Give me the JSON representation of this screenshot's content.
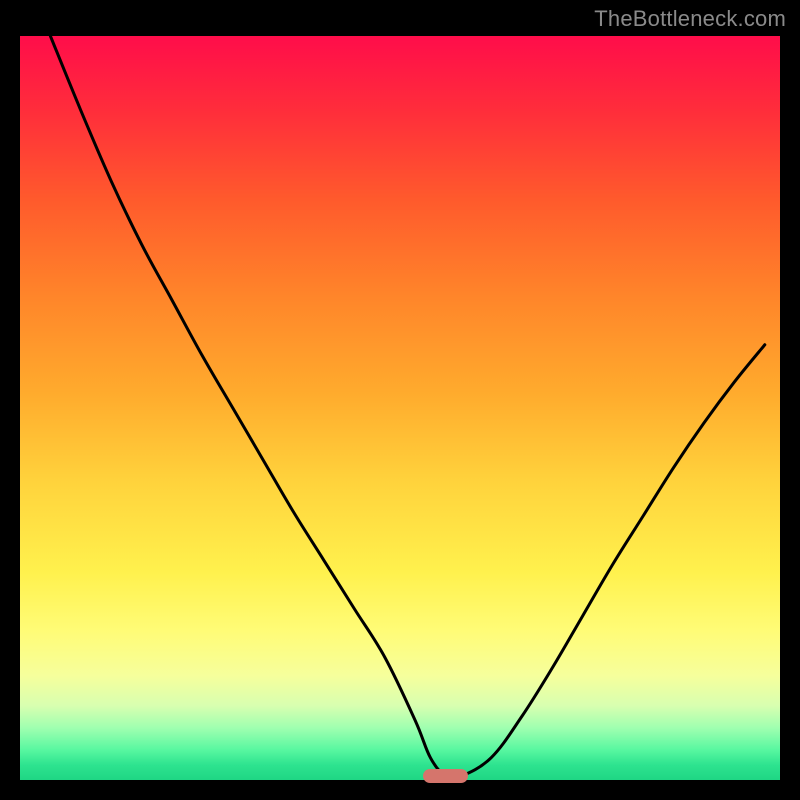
{
  "watermark": "TheBottleneck.com",
  "chart_data": {
    "type": "line",
    "title": "",
    "xlabel": "",
    "ylabel": "",
    "xlim": [
      0,
      100
    ],
    "ylim": [
      0,
      100
    ],
    "grid": false,
    "legend": false,
    "background_gradient": {
      "top": "#ff0d4a",
      "mid": "#ffd33c",
      "bottom": "#1fd684"
    },
    "series": [
      {
        "name": "bottleneck-curve",
        "x": [
          4.0,
          8.0,
          12.0,
          16.0,
          20.0,
          24.0,
          28.0,
          32.0,
          36.0,
          40.0,
          44.0,
          48.0,
          52.0,
          54.0,
          56.0,
          58.0,
          62.0,
          66.0,
          70.0,
          74.0,
          78.0,
          82.0,
          86.0,
          90.0,
          94.0,
          98.0
        ],
        "y": [
          100.0,
          90.0,
          80.5,
          72.0,
          64.5,
          57.0,
          50.0,
          43.0,
          36.0,
          29.5,
          23.0,
          16.5,
          8.0,
          3.0,
          0.5,
          0.5,
          3.0,
          8.5,
          15.0,
          22.0,
          29.0,
          35.5,
          42.0,
          48.0,
          53.5,
          58.5
        ],
        "stroke": "#000000",
        "stroke_width": 3
      }
    ],
    "marker": {
      "name": "optimal-range",
      "x_range": [
        53.0,
        59.0
      ],
      "y": 0.5,
      "color": "#d5756c"
    }
  }
}
